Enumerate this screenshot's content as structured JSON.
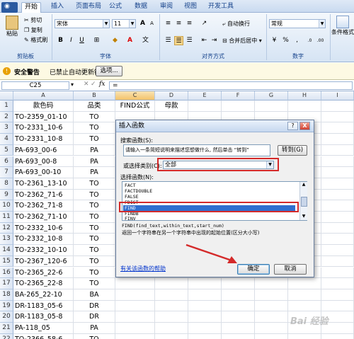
{
  "tabs": [
    "开始",
    "插入",
    "页面布局",
    "公式",
    "数据",
    "审阅",
    "视图",
    "开发工具"
  ],
  "ribbon": {
    "paste": "粘贴",
    "cut": "剪切",
    "copy": "复制",
    "format_painter": "格式刷",
    "font_name": "宋体",
    "font_size": "11",
    "bold": "B",
    "italic": "I",
    "underline": "U",
    "grow_font": "A",
    "shrink_font": "A",
    "font_color": "A",
    "wen": "文",
    "wrap_text": "自动换行",
    "merge_center": "合并后居中",
    "number_format": "常规",
    "conditional_format": "条件格式",
    "clipboard_label": "剪贴板",
    "font_label": "字体",
    "align_label": "对齐方式",
    "number_label": "数字"
  },
  "security": {
    "title": "安全警告",
    "message": "已禁止自动更新链接",
    "options_button": "选项..."
  },
  "formula_bar": {
    "name_box": "C25",
    "fx": "fx",
    "equals": "="
  },
  "columns": [
    "A",
    "B",
    "C",
    "D",
    "E",
    "F",
    "G",
    "H",
    "I"
  ],
  "rows": [
    {
      "n": "1",
      "a": "款色码",
      "b": "品类",
      "c": "FIND公式",
      "d": "母款"
    },
    {
      "n": "2",
      "a": "TO-2359_01-10",
      "b": "TO"
    },
    {
      "n": "3",
      "a": "TO-2331_10-6",
      "b": "TO"
    },
    {
      "n": "4",
      "a": "TO-2331_10-8",
      "b": "TO"
    },
    {
      "n": "5",
      "a": "PA-693_00-6",
      "b": "PA"
    },
    {
      "n": "6",
      "a": "PA-693_00-8",
      "b": "PA"
    },
    {
      "n": "7",
      "a": "PA-693_00-10",
      "b": "PA"
    },
    {
      "n": "8",
      "a": "TO-2361_13-10",
      "b": "TO"
    },
    {
      "n": "9",
      "a": "TO-2362_71-6",
      "b": "TO"
    },
    {
      "n": "10",
      "a": "TO-2362_71-8",
      "b": "TO"
    },
    {
      "n": "11",
      "a": "TO-2362_71-10",
      "b": "TO"
    },
    {
      "n": "12",
      "a": "TO-2332_10-6",
      "b": "TO"
    },
    {
      "n": "13",
      "a": "TO-2332_10-8",
      "b": "TO"
    },
    {
      "n": "14",
      "a": "TO-2332_10-10",
      "b": "TO"
    },
    {
      "n": "15",
      "a": "TO-2367_120-6",
      "b": "TO"
    },
    {
      "n": "16",
      "a": "TO-2365_22-6",
      "b": "TO"
    },
    {
      "n": "17",
      "a": "TO-2365_22-8",
      "b": "TO"
    },
    {
      "n": "18",
      "a": "BA-265_22-10",
      "b": "BA"
    },
    {
      "n": "19",
      "a": "DR-1183_05-6",
      "b": "DR"
    },
    {
      "n": "20",
      "a": "DR-1183_05-8",
      "b": "DR"
    },
    {
      "n": "21",
      "a": "PA-118_05",
      "b": "PA"
    },
    {
      "n": "22",
      "a": "TO-2366_58-6",
      "b": "TO"
    }
  ],
  "dialog": {
    "title": "插入函数",
    "help_button": "?",
    "close_button": "X",
    "search_label": "搜索函数(S):",
    "search_placeholder": "请输入一条简短说明来描述您想做什么, 然后单击 “转到”",
    "go_button": "转到(G)",
    "category_label": "或选择类别(C):",
    "category_value": "全部",
    "select_label": "选择函数(N):",
    "functions": [
      "FACT",
      "FACTDOUBLE",
      "FALSE",
      "FDIST",
      "FIND",
      "FINDB",
      "FINV"
    ],
    "selected_function": "FIND",
    "signature": "FIND(find_text,within_text,start_num)",
    "description": "返回一个字符串在另一个字符串中出现的起始位置(区分大小写)",
    "help_link": "有关该函数的帮助",
    "ok_button": "确定",
    "cancel_button": "取消"
  },
  "watermark": "Bai 经验",
  "colors": {
    "accent": "#2f6fcf",
    "highlight": "#d42a2a"
  }
}
